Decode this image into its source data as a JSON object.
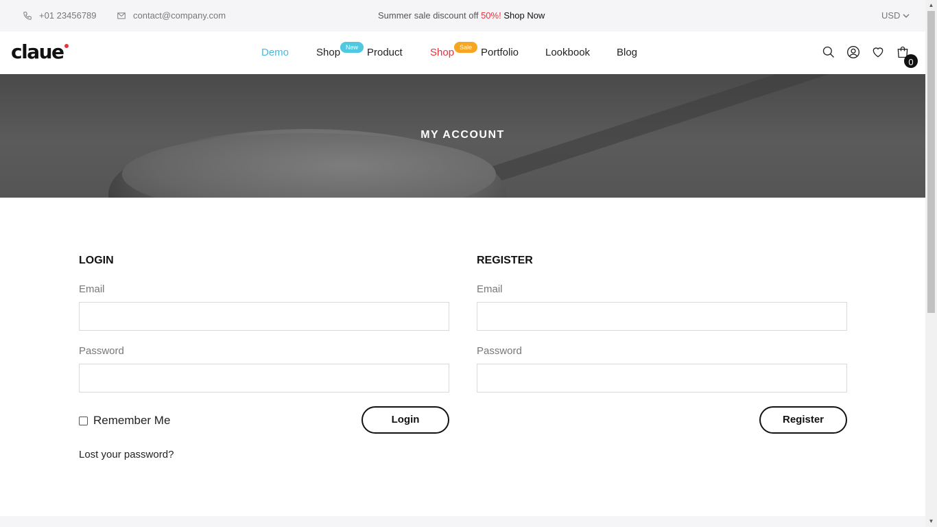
{
  "topbar": {
    "phone": "+01 23456789",
    "email": "contact@company.com",
    "promo_text": "Summer sale discount off",
    "promo_percent": "50%!",
    "promo_link": "Shop Now",
    "currency": "USD"
  },
  "header": {
    "logo": "claue",
    "nav": [
      {
        "label": "Demo"
      },
      {
        "label": "Shop",
        "badge": "New"
      },
      {
        "label": "Product"
      },
      {
        "label": "Shop",
        "badge": "Sale"
      },
      {
        "label": "Portfolio"
      },
      {
        "label": "Lookbook"
      },
      {
        "label": "Blog"
      }
    ],
    "cart_count": "0"
  },
  "hero": {
    "title": "MY ACCOUNT"
  },
  "login": {
    "heading": "LOGIN",
    "email_label": "Email",
    "email_value": "",
    "password_label": "Password",
    "password_value": "",
    "remember_label": "Remember Me",
    "button": "Login",
    "lost_password": "Lost your password?"
  },
  "register": {
    "heading": "REGISTER",
    "email_label": "Email",
    "email_value": "",
    "password_label": "Password",
    "password_value": "",
    "button": "Register"
  },
  "colors": {
    "accent": "#4bb9d6",
    "sale_red": "#e8323c",
    "badge_new": "#4fc8e0",
    "badge_sale": "#f6a623"
  }
}
